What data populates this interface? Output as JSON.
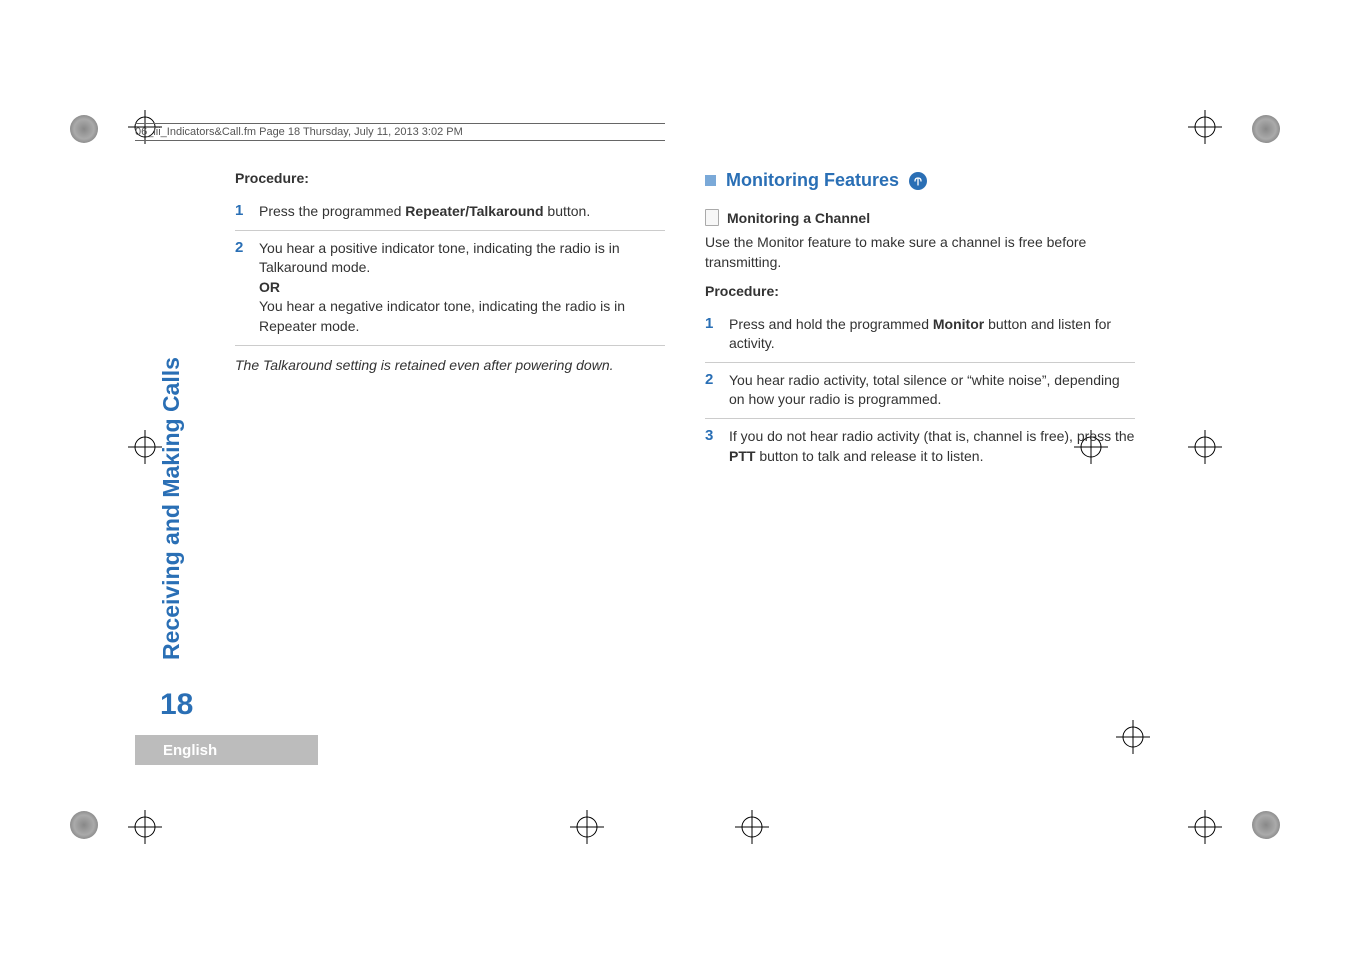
{
  "header": {
    "runningHead": "06_iii_Indicators&Call.fm  Page 18  Thursday, July 11, 2013  3:02 PM"
  },
  "leftColumn": {
    "procedureLabel": "Procedure:",
    "steps": [
      {
        "num": "1",
        "lines": [
          "Press the programmed ",
          "Repeater/Talkaround",
          " button."
        ]
      },
      {
        "num": "2",
        "line1": "You hear a positive indicator tone, indicating the radio is in Talkaround mode.",
        "or": "OR",
        "line2": "You hear a negative indicator tone, indicating the radio is in Repeater mode."
      }
    ],
    "note": "The Talkaround setting is retained even after powering down."
  },
  "rightColumn": {
    "sectionTitle": "Monitoring Features",
    "subHeading": "Monitoring a Channel",
    "intro": "Use the Monitor feature to make sure a channel is free before transmitting.",
    "procedureLabel": "Procedure:",
    "steps": [
      {
        "num": "1",
        "pre": "Press and hold the programmed ",
        "bold": "Monitor",
        "post": " button and listen for activity."
      },
      {
        "num": "2",
        "text": "You hear radio activity, total silence or “white noise”, depending on how your radio is programmed."
      },
      {
        "num": "3",
        "pre": "If you do not hear radio activity (that is, channel is free), press the ",
        "bold": "PTT",
        "post": " button to talk and release it to listen."
      }
    ]
  },
  "sidebar": {
    "verticalLabel": "Receiving and Making Calls",
    "pageNumber": "18",
    "language": "English"
  },
  "icons": {
    "monitoringFeatureIcon": "antenna-circle-icon",
    "sectionSquare": "section-square-icon",
    "pageIcon": "page-outline-icon",
    "registrationMark": "registration-mark-icon",
    "cornerDot": "corner-dot-icon"
  }
}
